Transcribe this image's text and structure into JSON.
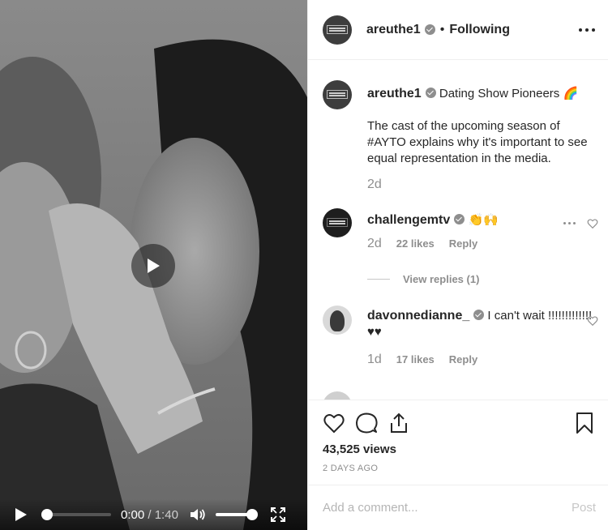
{
  "video": {
    "current_time": "0:00",
    "separator": " / ",
    "duration": "1:40",
    "progress_fraction": 0,
    "volume_fraction": 1
  },
  "header": {
    "username": "areuthe1",
    "dot": "•",
    "follow_status": "Following"
  },
  "caption": {
    "username": "areuthe1",
    "headline": "Dating Show Pioneers 🌈",
    "text": "The cast of the upcoming season of #AYTO explains why it's important to see equal representation in the media.",
    "age": "2d"
  },
  "comments": [
    {
      "username": "challengemtv",
      "text": "👏🙌",
      "age": "2d",
      "likes": "22 likes",
      "reply_label": "Reply"
    },
    {
      "username": "davonnedianne_",
      "text": "I can't wait !!!!!!!!!!!!! ♥♥",
      "age": "1d",
      "likes": "17 likes",
      "reply_label": "Reply"
    }
  ],
  "view_replies": "View replies (1)",
  "stats": {
    "views": "43,525 views",
    "date": "2 DAYS AGO"
  },
  "add_comment": {
    "placeholder": "Add a comment...",
    "post_label": "Post"
  },
  "icons": {
    "like": "heart-icon",
    "comment": "comment-icon",
    "share": "share-icon",
    "save": "bookmark-icon",
    "play": "play-icon",
    "volume": "volume-icon",
    "fullscreen": "fullscreen-icon",
    "more": "more-options-icon"
  }
}
